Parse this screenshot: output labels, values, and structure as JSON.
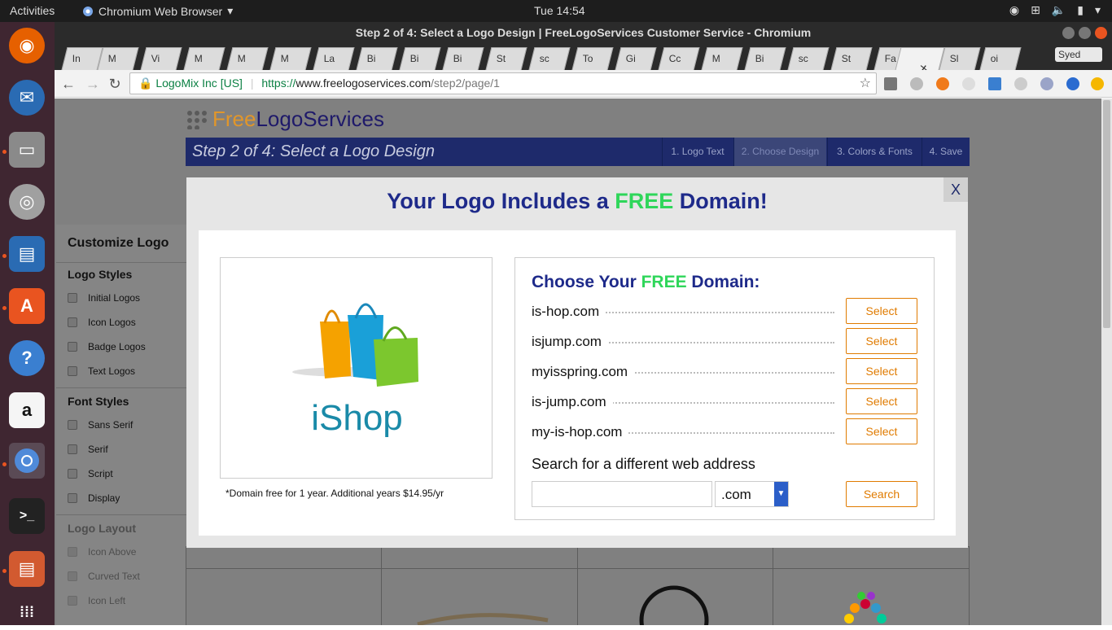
{
  "system": {
    "activities": "Activities",
    "app_name": "Chromium Web Browser",
    "clock": "Tue 14:54"
  },
  "window": {
    "title": "Step 2 of 4: Select a Logo Design | FreeLogoServices Customer Service - Chromium"
  },
  "tabs": [
    {
      "label": "In"
    },
    {
      "label": "M"
    },
    {
      "label": "Vi"
    },
    {
      "label": "M"
    },
    {
      "label": "M"
    },
    {
      "label": "M"
    },
    {
      "label": "La"
    },
    {
      "label": "Bi"
    },
    {
      "label": "Bi"
    },
    {
      "label": "Bi"
    },
    {
      "label": "St"
    },
    {
      "label": "sc"
    },
    {
      "label": "To"
    },
    {
      "label": "Gi"
    },
    {
      "label": "Cc"
    },
    {
      "label": "M"
    },
    {
      "label": "Bi"
    },
    {
      "label": "sc"
    },
    {
      "label": "St"
    },
    {
      "label": "Fa"
    },
    {
      "label": ""
    },
    {
      "label": "Sl"
    },
    {
      "label": "oi"
    }
  ],
  "user": "Syed",
  "omnibox": {
    "security": "LogoMix Inc [US]",
    "proto": "https://",
    "host": "www.freelogoservices.com",
    "path": "/step2/page/1"
  },
  "site": {
    "logo_free": "Free",
    "logo_rest": "LogoServices",
    "step_title": "Step 2 of 4: Select a Logo Design",
    "steps": [
      "1. Logo Text",
      "2. Choose Design",
      "3. Colors & Fonts",
      "4. Save"
    ]
  },
  "sidebar": {
    "title": "Customize Logo",
    "logo_styles": "Logo Styles",
    "logo_opts": [
      "Initial Logos",
      "Icon Logos",
      "Badge Logos",
      "Text Logos"
    ],
    "font_styles": "Font Styles",
    "font_opts": [
      "Sans Serif",
      "Serif",
      "Script",
      "Display"
    ],
    "layout": "Logo Layout",
    "layout_opts": [
      "Icon Above",
      "Curved Text",
      "Icon Left"
    ]
  },
  "modal": {
    "close": "X",
    "title_a": "Your Logo Includes a ",
    "title_free": "FREE",
    "title_b": " Domain!",
    "preview_text": "iShop",
    "note": "*Domain free for 1 year. Additional years $14.95/yr",
    "choose_a": "Choose Your ",
    "choose_free": "FREE",
    "choose_b": " Domain:",
    "domains": [
      {
        "name": "is-hop.com",
        "button": "Select"
      },
      {
        "name": "isjump.com",
        "button": "Select"
      },
      {
        "name": "myisspring.com",
        "button": "Select"
      },
      {
        "name": "is-jump.com",
        "button": "Select"
      },
      {
        "name": "my-is-hop.com",
        "button": "Select"
      }
    ],
    "search_label": "Search for a different web address",
    "search_value": "",
    "tld": ".com",
    "search_button": "Search"
  },
  "colors": {
    "brand_navy": "#1e2a8a",
    "free_green": "#2fd65a",
    "button_orange": "#e07b00"
  }
}
